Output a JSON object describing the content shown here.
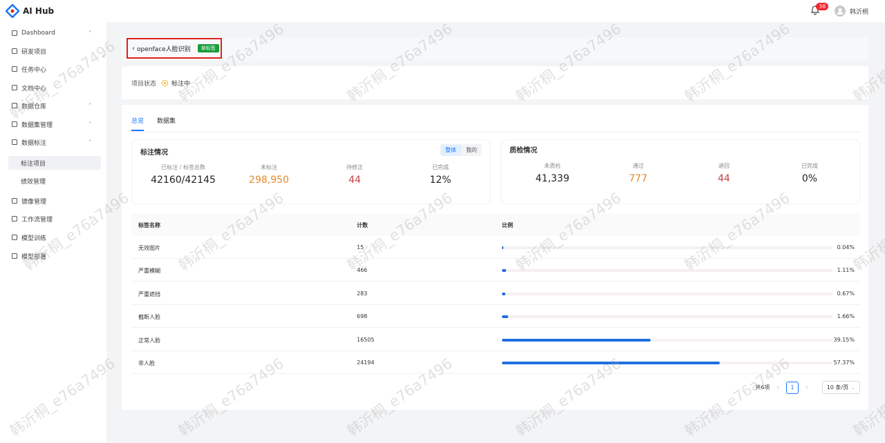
{
  "app": {
    "name": "AI Hub",
    "notification_count": "38",
    "username": "韩沂桐"
  },
  "sidebar": {
    "items": [
      {
        "label": "Dashboard",
        "icon": "dashboard-icon",
        "expandable": true
      },
      {
        "label": "研发项目",
        "icon": "folder-icon"
      },
      {
        "label": "任务中心",
        "icon": "task-icon"
      },
      {
        "label": "文档中心",
        "icon": "doc-icon"
      },
      {
        "label": "数据仓库",
        "icon": "home-icon",
        "expandable": true
      },
      {
        "label": "数据集管理",
        "icon": "database-icon",
        "expandable": true
      },
      {
        "label": "数据标注",
        "icon": "pen-icon",
        "expanded": true
      },
      {
        "label": "标注项目",
        "sub": true,
        "active": true
      },
      {
        "label": "绩效管理",
        "sub": true
      },
      {
        "label": "镜像管理",
        "icon": "docker-icon"
      },
      {
        "label": "工作流管理",
        "icon": "workflow-icon",
        "expandable": true
      },
      {
        "label": "模型训练",
        "icon": "model-icon"
      },
      {
        "label": "模型部署",
        "icon": "cube-icon"
      }
    ]
  },
  "header": {
    "title": "openface人脸识别",
    "tag": "单标签"
  },
  "status": {
    "label": "项目状态",
    "value": "标注中"
  },
  "tabs": [
    "总览",
    "数据集"
  ],
  "annotation": {
    "title": "标注情况",
    "toggle": [
      "整体",
      "我的"
    ],
    "stats": [
      {
        "label": "已标注 / 标签总数",
        "value": "42160/42145"
      },
      {
        "label": "未标注",
        "value": "298,950"
      },
      {
        "label": "待修正",
        "value": "44"
      },
      {
        "label": "已完成",
        "value": "12%"
      }
    ]
  },
  "quality": {
    "title": "质检情况",
    "stats": [
      {
        "label": "未质检",
        "value": "41,339"
      },
      {
        "label": "通过",
        "value": "777"
      },
      {
        "label": "退回",
        "value": "44"
      },
      {
        "label": "已完成",
        "value": "0%"
      }
    ]
  },
  "table": {
    "headers": [
      "标签名称",
      "计数",
      "比例"
    ],
    "rows": [
      {
        "name": "无效图片",
        "count": "15",
        "pct": "0.04%",
        "ratio": 0.0004
      },
      {
        "name": "严重模糊",
        "count": "466",
        "pct": "1.11%",
        "ratio": 0.0111
      },
      {
        "name": "严重遮挡",
        "count": "283",
        "pct": "0.67%",
        "ratio": 0.0067
      },
      {
        "name": "截断人脸",
        "count": "698",
        "pct": "1.66%",
        "ratio": 0.0166
      },
      {
        "name": "正常人脸",
        "count": "16505",
        "pct": "39.15%",
        "ratio": 0.3915
      },
      {
        "name": "非人脸",
        "count": "24194",
        "pct": "57.37%",
        "ratio": 0.5737
      }
    ]
  },
  "pagination": {
    "total": "共6项",
    "page": "1",
    "page_size": "10 条/页"
  },
  "watermark": "韩沂桐_e76a7496",
  "colors": {
    "accent": "#1677ff",
    "bar": "#1f6fe0",
    "tag": "#1a9c3e",
    "highlight_border": "#e0201a"
  }
}
